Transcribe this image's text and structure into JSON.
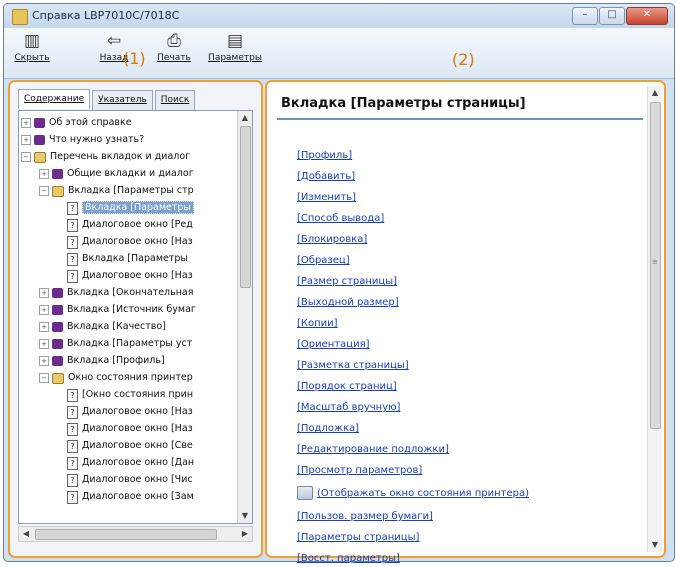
{
  "window": {
    "title": "Справка LBP7010C/7018C",
    "min_glyph": "–",
    "max_glyph": "□",
    "close_glyph": "✕"
  },
  "toolbar": {
    "hide_label": "Скрыть",
    "back_label": "Назад",
    "print_label": "Печать",
    "options_label": "Параметры"
  },
  "callouts": {
    "left": "(1)",
    "right": "(2)"
  },
  "tabs": [
    {
      "label": "Содержание",
      "active": true
    },
    {
      "label": "Указатель",
      "active": false
    },
    {
      "label": "Поиск",
      "active": false
    }
  ],
  "tree": [
    {
      "label": "Об этой справке",
      "icon": "book-closed-icon"
    },
    {
      "label": "Что нужно узнать?",
      "icon": "book-closed-icon"
    },
    {
      "label": "Перечень вкладок и диалог",
      "icon": "book-open-icon"
    },
    {
      "label": "Общие вкладки и диалог",
      "icon": "book-closed-icon"
    },
    {
      "label": "Вкладка [Параметры стр",
      "icon": "book-open-icon"
    },
    {
      "label": "Вкладка [Параметры",
      "icon": "help-page-icon",
      "selected": true
    },
    {
      "label": "Диалоговое окно [Ред",
      "icon": "help-page-icon"
    },
    {
      "label": "Диалоговое окно [Наз",
      "icon": "help-page-icon"
    },
    {
      "label": "Вкладка [Параметры",
      "icon": "help-page-icon"
    },
    {
      "label": "Диалоговое окно [Наз",
      "icon": "help-page-icon"
    },
    {
      "label": "Вкладка [Окончательная",
      "icon": "book-closed-icon"
    },
    {
      "label": "Вкладка [Источник бумаг",
      "icon": "book-closed-icon"
    },
    {
      "label": "Вкладка [Качество]",
      "icon": "book-closed-icon"
    },
    {
      "label": "Вкладка [Параметры уст",
      "icon": "book-closed-icon"
    },
    {
      "label": "Вкладка [Профиль]",
      "icon": "book-closed-icon"
    },
    {
      "label": "Окно состояния принтер",
      "icon": "book-open-icon"
    },
    {
      "label": "[Окно состояния прин",
      "icon": "help-page-icon"
    },
    {
      "label": "Диалоговое окно [Наз",
      "icon": "help-page-icon"
    },
    {
      "label": "Диалоговое окно [Наз",
      "icon": "help-page-icon"
    },
    {
      "label": "Диалоговое окно [Све",
      "icon": "help-page-icon"
    },
    {
      "label": "Диалоговое окно [Дан",
      "icon": "help-page-icon"
    },
    {
      "label": "Диалоговое окно [Чис",
      "icon": "help-page-icon"
    },
    {
      "label": "Диалоговое окно [Зам",
      "icon": "help-page-icon"
    }
  ],
  "content": {
    "heading": "Вкладка [Параметры страницы]",
    "links": [
      "[Профиль]",
      "[Добавить]",
      "[Изменить]",
      "[Способ вывода]",
      "[Блокировка]",
      "[Образец]",
      "[Размер страницы]",
      "[Выходной размер]",
      "[Копии]",
      "[Ориентация]",
      "[Разметка страницы]",
      "[Порядок страниц]",
      "[Масштаб вручную]",
      "[Подложка]",
      "[Редактирование подложки]",
      "[Просмотр параметров]",
      "(Отображать окно состояния принтера)",
      "[Пользов. размер бумаги]",
      "[Параметры страницы]",
      "[Восст. параметры]"
    ]
  }
}
